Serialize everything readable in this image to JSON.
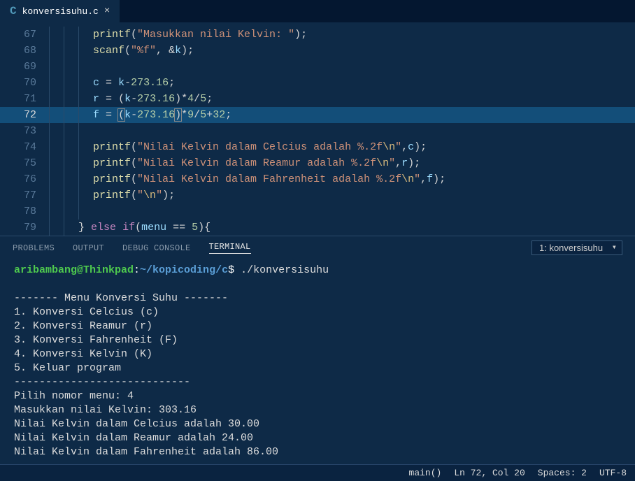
{
  "tab": {
    "icon": "C",
    "label": "konversisuhu.c",
    "close": "×"
  },
  "code": {
    "lines": [
      {
        "n": "67",
        "indent": 3,
        "html": "<span class='c-fn'>printf</span><span class='c-punc'>(</span><span class='c-str'>\"Masukkan nilai Kelvin: \"</span><span class='c-punc'>);</span>"
      },
      {
        "n": "68",
        "indent": 3,
        "html": "<span class='c-fn'>scanf</span><span class='c-punc'>(</span><span class='c-str'>\"%f\"</span><span class='c-punc'>, </span><span class='c-op'>&amp;</span><span class='c-var'>k</span><span class='c-punc'>);</span>"
      },
      {
        "n": "69",
        "indent": 3,
        "html": ""
      },
      {
        "n": "70",
        "indent": 3,
        "html": "<span class='c-var'>c</span> <span class='c-op'>=</span> <span class='c-var'>k</span><span class='c-op'>-</span><span class='c-num'>273.16</span><span class='c-punc'>;</span>"
      },
      {
        "n": "71",
        "indent": 3,
        "html": "<span class='c-var'>r</span> <span class='c-op'>=</span> <span class='c-punc'>(</span><span class='c-var'>k</span><span class='c-op'>-</span><span class='c-num'>273.16</span><span class='c-punc'>)</span><span class='c-op'>*</span><span class='c-num'>4</span><span class='c-op'>/</span><span class='c-num'>5</span><span class='c-punc'>;</span>"
      },
      {
        "n": "72",
        "indent": 3,
        "hl": true,
        "html": "<span class='c-var'>f</span> <span class='c-op'>=</span> <span class='c-punc c-paren-hl'>(</span><span class='c-var'>k</span><span class='c-op'>-</span><span class='c-num'>273.16</span><span class='c-punc c-paren-hl'>)</span><span class='c-op'>*</span><span class='c-num'>9</span><span class='c-op'>/</span><span class='c-num'>5</span><span class='c-op'>+</span><span class='c-num'>32</span><span class='c-punc'>;</span>"
      },
      {
        "n": "73",
        "indent": 3,
        "html": ""
      },
      {
        "n": "74",
        "indent": 3,
        "html": "<span class='c-fn'>printf</span><span class='c-punc'>(</span><span class='c-str'>\"Nilai Kelvin dalam Celcius adalah %.2f</span><span class='c-esc'>\\n</span><span class='c-str'>\"</span><span class='c-punc'>,</span><span class='c-var'>c</span><span class='c-punc'>);</span>"
      },
      {
        "n": "75",
        "indent": 3,
        "html": "<span class='c-fn'>printf</span><span class='c-punc'>(</span><span class='c-str'>\"Nilai Kelvin dalam Reamur adalah %.2f</span><span class='c-esc'>\\n</span><span class='c-str'>\"</span><span class='c-punc'>,</span><span class='c-var'>r</span><span class='c-punc'>);</span>"
      },
      {
        "n": "76",
        "indent": 3,
        "html": "<span class='c-fn'>printf</span><span class='c-punc'>(</span><span class='c-str'>\"Nilai Kelvin dalam Fahrenheit adalah %.2f</span><span class='c-esc'>\\n</span><span class='c-str'>\"</span><span class='c-punc'>,</span><span class='c-var'>f</span><span class='c-punc'>);</span>"
      },
      {
        "n": "77",
        "indent": 3,
        "html": "<span class='c-fn'>printf</span><span class='c-punc'>(</span><span class='c-str'>\"</span><span class='c-esc'>\\n</span><span class='c-str'>\"</span><span class='c-punc'>);</span>"
      },
      {
        "n": "78",
        "indent": 3,
        "html": ""
      },
      {
        "n": "79",
        "indent": 2,
        "html": "<span class='c-punc'>}</span> <span class='c-key'>else</span> <span class='c-key'>if</span><span class='c-punc'>(</span><span class='c-var'>menu</span> <span class='c-op'>==</span> <span class='c-num'>5</span><span class='c-punc'>){</span>"
      }
    ]
  },
  "panel": {
    "tabs": {
      "problems": "PROBLEMS",
      "output": "OUTPUT",
      "debug": "DEBUG CONSOLE",
      "terminal": "TERMINAL"
    },
    "terminal_select": "1: konversisuhu"
  },
  "terminal": {
    "user": "aribambang@Thinkpad",
    "path": "~/kopicoding/c",
    "prompt_symbol": "$",
    "command": "./konversisuhu",
    "output": [
      "",
      "------- Menu Konversi Suhu -------",
      "1. Konversi Celcius (c)",
      "2. Konversi Reamur (r)",
      "3. Konversi Fahrenheit (F)",
      "4. Konversi Kelvin (K)",
      "5. Keluar program",
      "----------------------------",
      "Pilih nomor menu: 4",
      "Masukkan nilai Kelvin: 303.16",
      "Nilai Kelvin dalam Celcius adalah 30.00",
      "Nilai Kelvin dalam Reamur adalah 24.00",
      "Nilai Kelvin dalam Fahrenheit adalah 86.00"
    ]
  },
  "status": {
    "scope": "main()",
    "position": "Ln 72, Col 20",
    "spaces": "Spaces: 2",
    "encoding": "UTF-8"
  }
}
